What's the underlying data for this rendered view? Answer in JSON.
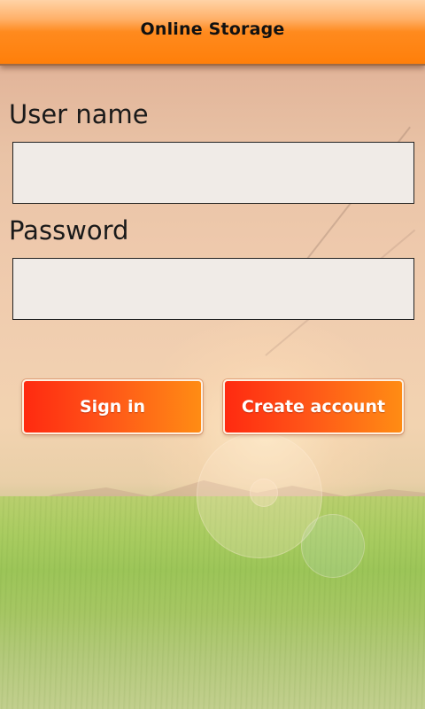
{
  "header": {
    "title": "Online Storage"
  },
  "form": {
    "username_label": "User name",
    "username_value": "",
    "password_label": "Password",
    "password_value": ""
  },
  "actions": {
    "signin_label": "Sign in",
    "create_account_label": "Create account"
  },
  "colors": {
    "header_orange": "#ff7f0a",
    "button_red": "#ff2a10",
    "button_orange": "#ff8c14",
    "field_background": "#f0ebe7"
  }
}
